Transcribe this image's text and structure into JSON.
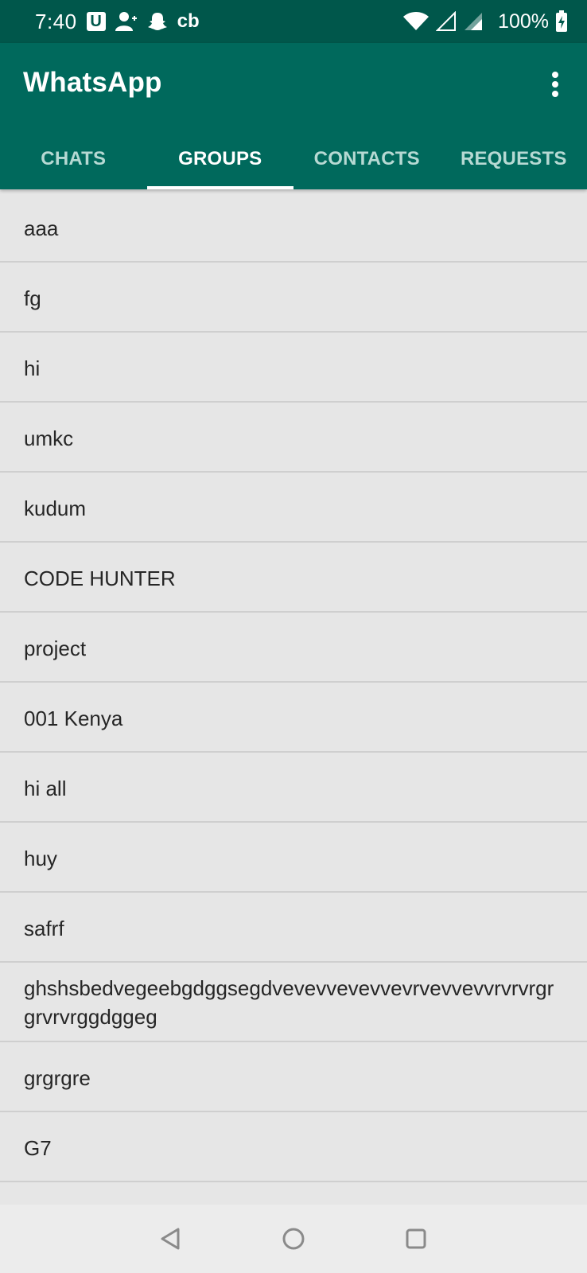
{
  "status_bar": {
    "time": "7:40",
    "u_icon_label": "U",
    "cb_label": "cb",
    "battery": "100%",
    "icons": [
      "u-badge-icon",
      "add-person-icon",
      "snapchat-icon",
      "cb-icon",
      "wifi-icon",
      "signal-empty-icon",
      "signal-icon",
      "battery-charging-icon"
    ]
  },
  "app_bar": {
    "title": "WhatsApp",
    "menu_icon": "more-vert-icon"
  },
  "tabs": [
    {
      "label": "CHATS",
      "active": false
    },
    {
      "label": "GROUPS",
      "active": true
    },
    {
      "label": "CONTACTS",
      "active": false
    },
    {
      "label": "REQUESTS",
      "active": false
    }
  ],
  "groups": [
    "aaa",
    "fg",
    "hi",
    "umkc",
    "kudum",
    "CODE HUNTER",
    "project",
    "001 Kenya",
    "hi all",
    "huy",
    "safrf",
    "ghshsbedvegeebgdggsegdvevevvevevvevrvevvevvrvrvrgrgrvrvrggdggeg",
    "grgrgre",
    "G7"
  ],
  "navigation": {
    "icons": [
      "back-icon",
      "home-icon",
      "recents-icon"
    ]
  },
  "colors": {
    "status_bar": "#00574b",
    "app_bar": "#00695c",
    "tab_inactive": "#b6d9d3",
    "list_background": "#e6e6e6",
    "divider": "#cfcfcf"
  }
}
